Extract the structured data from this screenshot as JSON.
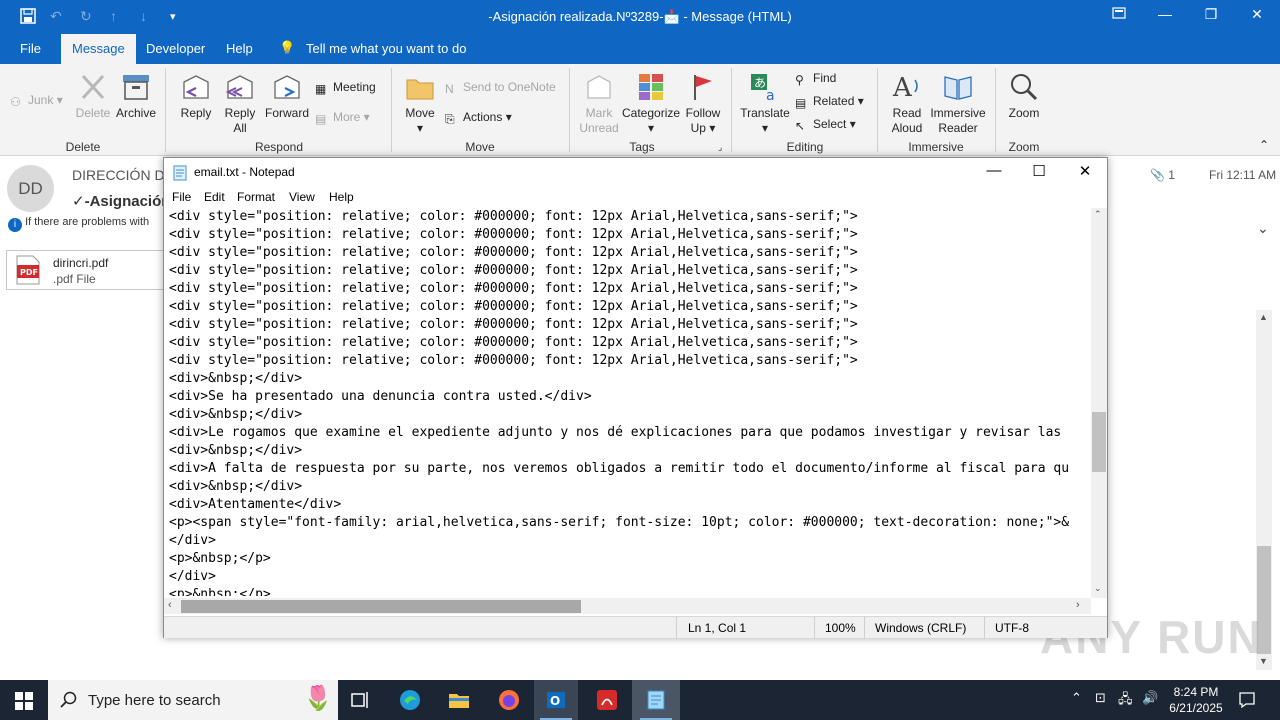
{
  "titlebar": {
    "title": "-Asignación realizada.Nº3289-📩 - Message (HTML)"
  },
  "tabs": [
    {
      "label": "File"
    },
    {
      "label": "Message"
    },
    {
      "label": "Developer"
    },
    {
      "label": "Help"
    }
  ],
  "tell_me": "Tell me what you want to do",
  "ribbon": {
    "delete": {
      "label": "Delete",
      "junk": "Junk",
      "delete_btn": "Delete",
      "archive": "Archive"
    },
    "respond": {
      "label": "Respond",
      "reply": "Reply",
      "reply_all_1": "Reply",
      "reply_all_2": "All",
      "forward": "Forward",
      "meeting": "Meeting",
      "more": "More"
    },
    "move": {
      "label": "Move",
      "move": "Move",
      "send_onenote": "Send to OneNote",
      "actions": "Actions"
    },
    "tags": {
      "label": "Tags",
      "mark_unread_1": "Mark",
      "mark_unread_2": "Unread",
      "categorize": "Categorize",
      "follow_up_1": "Follow",
      "follow_up_2": "Up"
    },
    "editing": {
      "label": "Editing",
      "translate": "Translate",
      "find": "Find",
      "related": "Related",
      "select": "Select"
    },
    "immersive": {
      "label": "Immersive",
      "read_aloud_1": "Read",
      "read_aloud_2": "Aloud",
      "immersive_reader_1": "Immersive",
      "immersive_reader_2": "Reader"
    },
    "zoom": {
      "label": "Zoom",
      "zoom": "Zoom"
    }
  },
  "message": {
    "avatar": "DD",
    "sender": "DIRECCIÓN D",
    "subject": "✓-Asignación",
    "infobar": "If there are problems with",
    "attachment_name": "dirincri.pdf",
    "attachment_type": ".pdf File",
    "attachment_count": "1",
    "time": "Fri 12:11 AM"
  },
  "notepad": {
    "title": "email.txt - Notepad",
    "menu": [
      "File",
      "Edit",
      "Format",
      "View",
      "Help"
    ],
    "lines": [
      "<div style=\"position: relative; color: #000000; font: 12px Arial,Helvetica,sans-serif;\">",
      "<div style=\"position: relative; color: #000000; font: 12px Arial,Helvetica,sans-serif;\">",
      "<div style=\"position: relative; color: #000000; font: 12px Arial,Helvetica,sans-serif;\">",
      "<div style=\"position: relative; color: #000000; font: 12px Arial,Helvetica,sans-serif;\">",
      "<div style=\"position: relative; color: #000000; font: 12px Arial,Helvetica,sans-serif;\">",
      "<div style=\"position: relative; color: #000000; font: 12px Arial,Helvetica,sans-serif;\">",
      "<div style=\"position: relative; color: #000000; font: 12px Arial,Helvetica,sans-serif;\">",
      "<div style=\"position: relative; color: #000000; font: 12px Arial,Helvetica,sans-serif;\">",
      "<div style=\"position: relative; color: #000000; font: 12px Arial,Helvetica,sans-serif;\">",
      "<div>&nbsp;</div>",
      "<div>Se ha presentado una denuncia contra usted.</div>",
      "<div>&nbsp;</div>",
      "<div>Le rogamos que examine el expediente adjunto y nos dé explicaciones para que podamos investigar y revisar las",
      "<div>&nbsp;</div>",
      "<div>A falta de respuesta por su parte, nos veremos obligados a remitir todo el documento/informe al fiscal para qu",
      "<div>&nbsp;</div>",
      "<div>Atentamente</div>",
      "<p><span style=\"font-family: arial,helvetica,sans-serif; font-size: 10pt; color: #000000; text-decoration: none;\">&",
      "</div>",
      "<p>&nbsp;</p>",
      "</div>",
      "<p>&nbsp;</p>"
    ],
    "status_position": "Ln 1, Col 1",
    "status_zoom": "100%",
    "status_eol": "Windows (CRLF)",
    "status_encoding": "UTF-8"
  },
  "taskbar": {
    "search_placeholder": "Type here to search",
    "time": "8:24 PM",
    "date": "6/21/2025"
  },
  "watermark": "ANY RUN",
  "colors": {
    "accent": "#1066c3",
    "taskbar": "#1c2533",
    "ribbon": "#f3f3f3"
  }
}
